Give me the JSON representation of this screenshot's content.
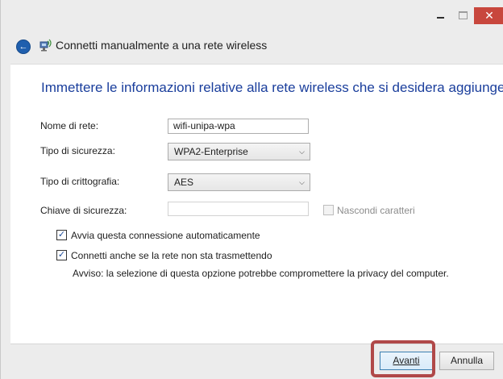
{
  "window": {
    "title": "Connetti manualmente a una rete wireless",
    "close_glyph": "✕",
    "back_glyph": "←"
  },
  "icons": {
    "back": "back-arrow-icon",
    "network": "wireless-network-icon",
    "minimize": "minimize-icon",
    "maximize": "maximize-icon",
    "close": "close-icon",
    "dropdown": "chevron-down-icon",
    "check": "checkmark-icon"
  },
  "form": {
    "heading": "Immettere le informazioni relative alla rete wireless che si desidera aggiungere",
    "network_name": {
      "label": "Nome di rete:",
      "value": "wifi-unipa-wpa"
    },
    "security_type": {
      "label": "Tipo di sicurezza:",
      "value": "WPA2-Enterprise"
    },
    "encryption_type": {
      "label": "Tipo di crittografia:",
      "value": "AES"
    },
    "security_key": {
      "label": "Chiave di sicurezza:",
      "value": "",
      "placeholder": ""
    },
    "hide_chars": {
      "label": "Nascondi caratteri",
      "checked": false,
      "enabled": false
    },
    "auto_connect": {
      "label": "Avvia questa connessione automaticamente",
      "checked": true
    },
    "connect_hidden": {
      "label": "Connetti anche se la rete non sta trasmettendo",
      "checked": true
    },
    "warning": "Avviso: la selezione di questa opzione potrebbe compromettere la privacy del computer."
  },
  "buttons": {
    "next": "Avanti",
    "cancel": "Annulla"
  },
  "glyphs": {
    "check": "✓",
    "chevron": "⌵"
  },
  "colors": {
    "heading": "#1a3e9c",
    "close_button": "#c8473d",
    "highlight": "#b04848",
    "back_button": "#1f5fae"
  }
}
